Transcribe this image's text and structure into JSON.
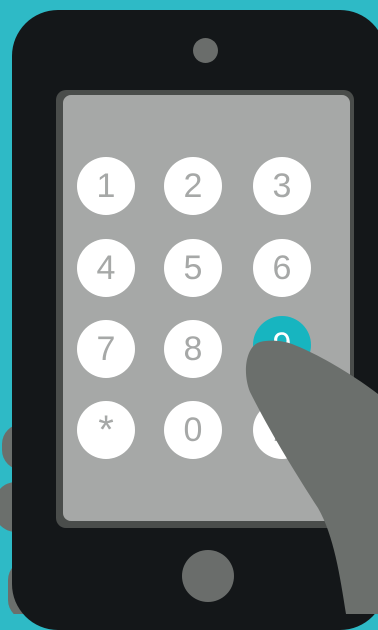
{
  "colors": {
    "background": "#2ebac6",
    "phone_body": "#141719",
    "screen": "#a6a8a7",
    "key_face": "#ffffff",
    "key_label": "#a6a8a7",
    "active_key": "#17b5c0",
    "hand": "#6b6f6c"
  },
  "keypad": {
    "active_key": "9",
    "keys": [
      {
        "label": "1"
      },
      {
        "label": "2"
      },
      {
        "label": "3"
      },
      {
        "label": "4"
      },
      {
        "label": "5"
      },
      {
        "label": "6"
      },
      {
        "label": "7"
      },
      {
        "label": "8"
      },
      {
        "label": "9"
      },
      {
        "label": "*"
      },
      {
        "label": "0"
      },
      {
        "label": "#"
      }
    ]
  }
}
